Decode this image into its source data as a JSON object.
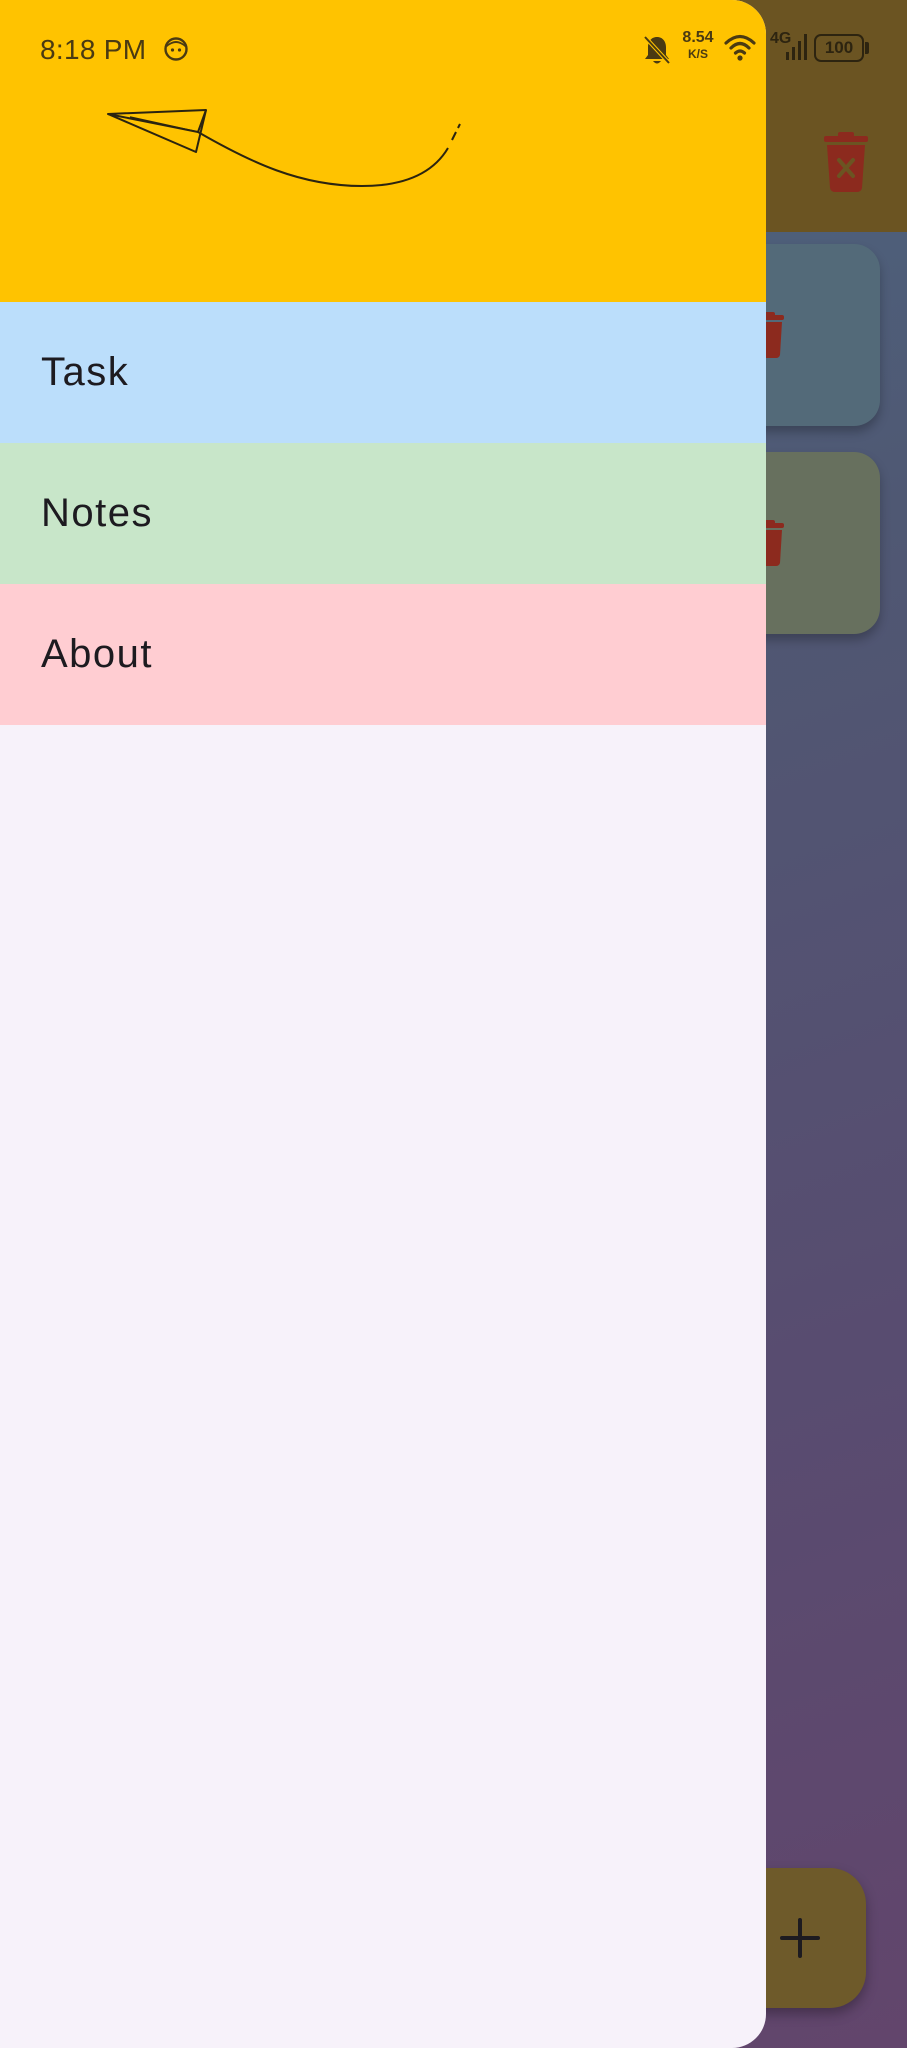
{
  "status_bar": {
    "time": "8:18 PM",
    "net_speed_value": "8.54",
    "net_speed_unit": "K/S",
    "network_type": "4G",
    "battery": "100",
    "icons": [
      "face-icon",
      "bell-off-icon",
      "wifi-icon",
      "signal-icon",
      "battery-icon"
    ]
  },
  "drawer": {
    "header_art": "paper-plane-icon",
    "header_color": "#ffc300",
    "items": [
      {
        "label": "Task",
        "color": "#bbdefb"
      },
      {
        "label": "Notes",
        "color": "#c8e6c9"
      },
      {
        "label": "About",
        "color": "#ffcdd2"
      }
    ],
    "background_color": "#f7f2fa"
  },
  "background_app": {
    "appbar_action_icon": "delete-sweep-icon",
    "card_icon": "trash-icon",
    "fab_icon": "plus-icon"
  }
}
